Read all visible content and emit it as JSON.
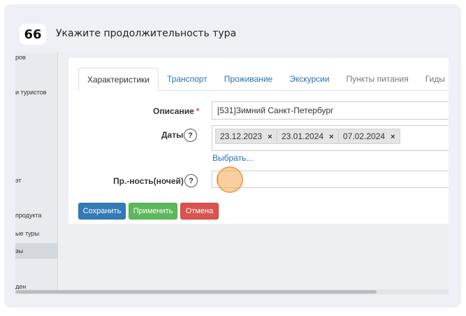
{
  "step": {
    "number": "66",
    "title": "Укажите продолжительность тура"
  },
  "sidebar": {
    "items": [
      {
        "label": "ров"
      },
      {
        "label": "и туристов"
      },
      {
        "label": "эт"
      },
      {
        "label": "продукта"
      },
      {
        "label": "ые туры"
      },
      {
        "label": "эы"
      },
      {
        "label": "ден"
      }
    ]
  },
  "tabs": [
    {
      "label": "Характеристики"
    },
    {
      "label": "Транспорт"
    },
    {
      "label": "Проживание"
    },
    {
      "label": "Экскурсии"
    },
    {
      "label": "Пункты питания"
    },
    {
      "label": "Гиды"
    }
  ],
  "form": {
    "description_label": "Описание",
    "required_marker": "*",
    "description_value": "[531]Зимний Санкт-Петербург",
    "dates_label": "Даты",
    "help_glyph": "?",
    "dates": [
      "23.12.2023",
      "23.01.2024",
      "07.02.2024"
    ],
    "chip_remove_glyph": "×",
    "select_link": "Выбрать...",
    "duration_label": "Пр.-ность(ночей)",
    "duration_value": ""
  },
  "buttons": {
    "save": "Сохранить",
    "apply": "Применить",
    "cancel": "Отмена"
  },
  "colors": {
    "primary": "#337ab7",
    "success": "#5cb85c",
    "danger": "#d9534f",
    "link": "#2a6fb5",
    "highlight": "#f4a850"
  }
}
